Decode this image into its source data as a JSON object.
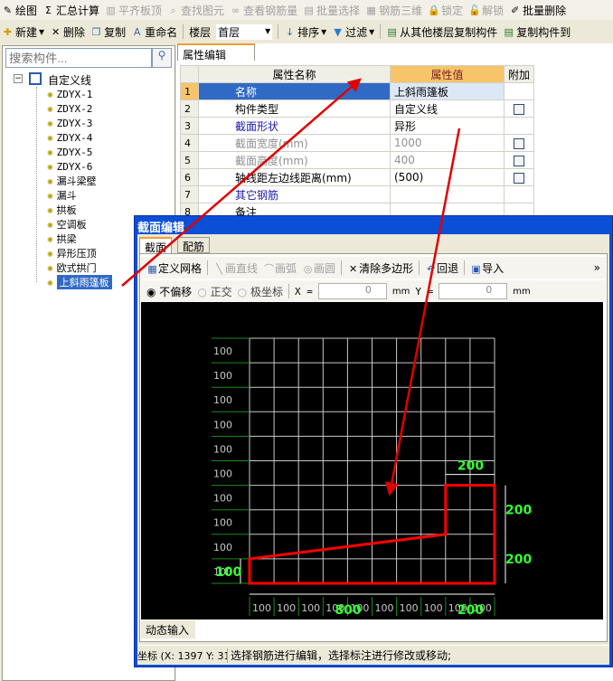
{
  "toolbar1": [
    {
      "icon": "draw-icon",
      "label": "绘图",
      "disabled": false
    },
    {
      "icon": "sigma-icon",
      "label": "汇总计算",
      "disabled": false
    },
    {
      "icon": "align-slab-icon",
      "label": "平齐板顶",
      "disabled": true
    },
    {
      "icon": "find-icon",
      "label": "查找图元",
      "disabled": true
    },
    {
      "icon": "glasses-icon",
      "label": "查看钢筋量",
      "disabled": true
    },
    {
      "icon": "batch-select-icon",
      "label": "批量选择",
      "disabled": true
    },
    {
      "icon": "rebar-3d-icon",
      "label": "钢筋三维",
      "disabled": true
    },
    {
      "icon": "lock-icon",
      "label": "锁定",
      "disabled": true
    },
    {
      "icon": "unlock-icon",
      "label": "解锁",
      "disabled": true
    },
    {
      "icon": "batch-delete-icon",
      "label": "批量删除",
      "disabled": false
    }
  ],
  "toolbar2": {
    "new": "新建",
    "delete": "删除",
    "copy": "复制",
    "rename": "重命名",
    "floor_label": "楼层",
    "floor_value": "首层",
    "sort": "排序",
    "filter": "过滤",
    "copy_from_floor": "从其他楼层复制构件",
    "copy_to": "复制构件到"
  },
  "sidebar": {
    "search_placeholder": "搜索构件...",
    "root": "自定义线",
    "items": [
      "ZDYX-1",
      "ZDYX-2",
      "ZDYX-3",
      "ZDYX-4",
      "ZDYX-5",
      "ZDYX-6",
      "漏斗梁壁",
      "漏斗",
      "拱板",
      "空调板",
      "拱梁",
      "异形压顶",
      "欧式拱门",
      "上斜雨篷板"
    ],
    "selected": "上斜雨篷板"
  },
  "properties": {
    "tab": "属性编辑",
    "headers": [
      "属性名称",
      "属性值",
      "附加"
    ],
    "rows": [
      {
        "n": "1",
        "name": "名称",
        "value": "上斜雨篷板",
        "style": "sel",
        "check": false
      },
      {
        "n": "2",
        "name": "构件类型",
        "value": "自定义线",
        "style": "",
        "check": true
      },
      {
        "n": "3",
        "name": "截面形状",
        "value": "异形",
        "style": "blue",
        "check": false
      },
      {
        "n": "4",
        "name": "截面宽度(mm)",
        "value": "1000",
        "style": "gray",
        "check": true
      },
      {
        "n": "5",
        "name": "截面高度(mm)",
        "value": "400",
        "style": "gray",
        "check": true
      },
      {
        "n": "6",
        "name": "轴线距左边线距离(mm)",
        "value": "(500)",
        "style": "",
        "check": true
      },
      {
        "n": "7",
        "name": "其它钢筋",
        "value": "",
        "style": "blue",
        "check": false
      },
      {
        "n": "8",
        "name": "备注",
        "value": "",
        "style": "",
        "check": false
      }
    ]
  },
  "dialog": {
    "title": "截面编辑",
    "tabs": [
      "截面",
      "配筋"
    ],
    "active_tab": "截面",
    "toolbar": {
      "grid": "定义网格",
      "line": "画直线",
      "arc": "画弧",
      "circle": "画圆",
      "clear": "清除多边形",
      "undo": "回退",
      "import": "导入",
      "more": "»"
    },
    "snap": {
      "options": [
        "不偏移",
        "正交",
        "极坐标"
      ],
      "selected": "不偏移",
      "x_label": "X =",
      "x_value": "0",
      "y_label": "Y =",
      "y_value": "0",
      "unit": "mm"
    },
    "grid": {
      "cols": 10,
      "rows": 10,
      "spacing_label": "100"
    },
    "shape_mm": [
      [
        0,
        0
      ],
      [
        1000,
        0
      ],
      [
        1000,
        400
      ],
      [
        800,
        400
      ],
      [
        800,
        200
      ],
      [
        0,
        100
      ]
    ],
    "dims": {
      "top": "200",
      "right_upper": "200",
      "right_lower": "200",
      "left": "100",
      "bottom_left": "800",
      "bottom_right": "200"
    },
    "dynamic_input": "动态输入",
    "status_coord": "坐标 (X: 1397 Y: 31",
    "status_msg": "选择钢筋进行编辑，选择标注进行修改或移动;"
  },
  "colors": {
    "shape": "#ff0000",
    "grid": "#c8c8c8",
    "dim_text": "#33ff33",
    "annotation_arrow": "#e00000",
    "selection": "#316ac5"
  }
}
